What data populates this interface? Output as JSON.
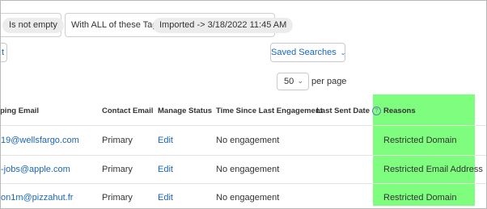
{
  "filters": {
    "condition_pill": "Is not empty",
    "tags_label": "With ALL of these Tags:",
    "tag_pill": "Imported -> 3/18/2022 11:45 AM"
  },
  "toolbar": {
    "left_stub_label": "t",
    "saved_searches_label": "Saved Searches",
    "saved_searches_chevron_icon": "chevron-down-icon"
  },
  "pagination": {
    "per_page_value": "50",
    "per_page_label": "per page"
  },
  "colors": {
    "highlight": "#7ffd7f",
    "link": "#1a66b8"
  },
  "table": {
    "headers": {
      "bouncing_email": "ping Email",
      "contact_email": "Contact Email",
      "manage_status": "Manage Status",
      "time_since": "Time Since Last Engagement",
      "last_sent": "Last Sent Date",
      "reasons": "Reasons"
    },
    "rows": [
      {
        "email": "19@wellsfargo.com",
        "contact": "Primary",
        "manage": "Edit",
        "engagement": "No engagement",
        "last_sent": "",
        "reason": "Restricted Domain"
      },
      {
        "email": "-jobs@apple.com",
        "contact": "Primary",
        "manage": "Edit",
        "engagement": "No engagement",
        "last_sent": "",
        "reason": "Restricted Email Address"
      },
      {
        "email": "on1m@pizzahut.fr",
        "contact": "Primary",
        "manage": "Edit",
        "engagement": "No engagement",
        "last_sent": "",
        "reason": "Restricted Domain"
      }
    ]
  }
}
